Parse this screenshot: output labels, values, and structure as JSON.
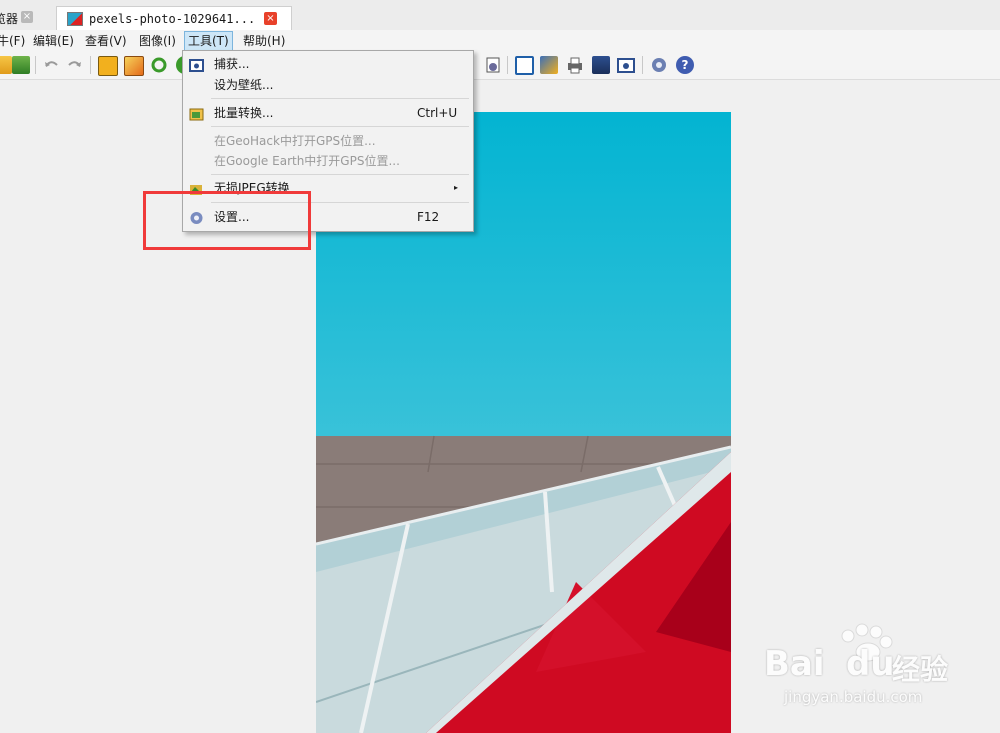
{
  "tabs": [
    {
      "title": "览器",
      "active": false
    },
    {
      "title": "pexels-photo-1029641...",
      "active": true
    }
  ],
  "tab_close_glyph": "×",
  "menubar": [
    {
      "label": "牛(F)"
    },
    {
      "label": "编辑(E)"
    },
    {
      "label": "查看(V)"
    },
    {
      "label": "图像(I)"
    },
    {
      "label": "工具(T)",
      "active": true
    },
    {
      "label": "帮助(H)"
    }
  ],
  "toolbar_icons": [
    "open-icon",
    "save-icon",
    "undo-icon",
    "redo-icon",
    "crop-icon",
    "resize-icon",
    "rotate-icon",
    "color-icon",
    "fullscreen-icon",
    "fit-icon",
    "edit-icon",
    "print-icon",
    "scanner-icon",
    "capture-icon",
    "settings-icon",
    "help-icon"
  ],
  "tools_menu": {
    "items": [
      {
        "label": "捕获...",
        "icon": "camera-icon",
        "disabled": false,
        "shortcut": ""
      },
      {
        "label": "设为壁纸...",
        "icon": "",
        "disabled": false,
        "shortcut": ""
      },
      {
        "label": "批量转换...",
        "icon": "batch-convert-icon",
        "disabled": false,
        "shortcut": "Ctrl+U"
      },
      {
        "label": "在GeoHack中打开GPS位置...",
        "icon": "",
        "disabled": true,
        "shortcut": ""
      },
      {
        "label": "在Google Earth中打开GPS位置...",
        "icon": "",
        "disabled": true,
        "shortcut": ""
      },
      {
        "label": "无损JPEG转换",
        "icon": "jpeg-transform-icon",
        "disabled": false,
        "shortcut": "",
        "submenu": true
      },
      {
        "label": "设置...",
        "icon": "gear-icon",
        "disabled": false,
        "shortcut": "F12"
      }
    ],
    "submenu_arrow": "▸"
  },
  "watermark": {
    "brand": "Bai",
    "brand2": "du",
    "cn": "经验",
    "url": "jingyan.baidu.com"
  },
  "colors": {
    "highlight": "#f03a3a",
    "menu_active": "#cde6f7",
    "sky": "#1fb2cf",
    "red": "#c8102e"
  }
}
